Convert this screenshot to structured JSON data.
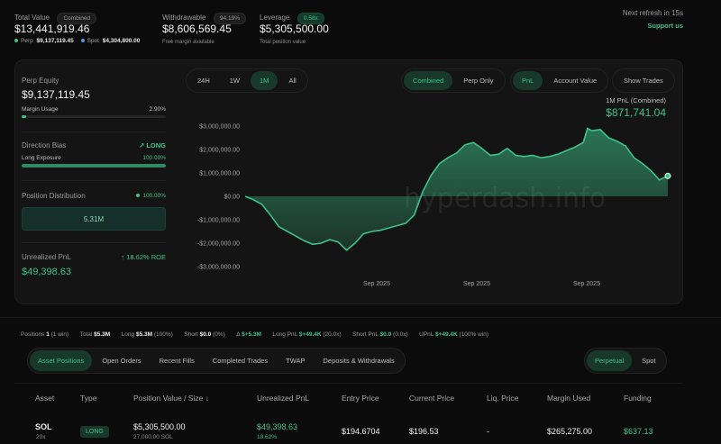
{
  "header": {
    "total_value_label": "Total Value",
    "total_value_badge": "Combined",
    "total_value": "$13,441,919.46",
    "perp_label": "Perp",
    "perp_value": "$9,137,119.45",
    "spot_label": "Spot",
    "spot_value": "$4,304,800.00",
    "withdrawable_label": "Withdrawable",
    "withdrawable_badge": "94.19%",
    "withdrawable_value": "$8,606,569.45",
    "withdrawable_sub": "Free margin available",
    "leverage_label": "Leverage",
    "leverage_badge": "0.58x",
    "leverage_value": "$5,305,500.00",
    "leverage_sub": "Total position value",
    "refresh_text": "Next refresh in 15s",
    "support_link": "Support us"
  },
  "sidebar": {
    "perp_equity_label": "Perp Equity",
    "perp_equity_value": "$9,137,119.45",
    "margin_usage_label": "Margin Usage",
    "margin_usage_value": "2.90%",
    "margin_usage_fraction": 0.029,
    "direction_bias_label": "Direction Bias",
    "direction_bias_value": "LONG",
    "long_exposure_label": "Long Exposure",
    "long_exposure_value": "100.00%",
    "long_exposure_fraction": 1.0,
    "position_distribution_label": "Position Distribution",
    "position_distribution_value": "100.00%",
    "distribution_box_value": "5.31M",
    "unrealized_pnl_label": "Unrealized PnL",
    "unrealized_roe": "18.62% ROE",
    "unrealized_pnl_value": "$49,398.63"
  },
  "chart_controls": {
    "ranges": [
      "24H",
      "1W",
      "1M",
      "All"
    ],
    "active_range": "1M",
    "modes": [
      "Combined",
      "Perp Only"
    ],
    "active_mode": "Combined",
    "metrics": [
      "PnL",
      "Account Value"
    ],
    "active_metric": "PnL",
    "show_trades": "Show Trades"
  },
  "chart_header": {
    "caption": "1M PnL (Combined)",
    "value": "$871,741.04"
  },
  "watermark": "hyperdash.info",
  "chart_data": {
    "type": "area",
    "y_ticks": [
      "$3,000,000.00",
      "$2,000,000.00",
      "$1,000,000.00",
      "$0.00",
      "-$1,000,000.00",
      "-$2,000,000.00",
      "-$3,000,000.00"
    ],
    "ylim": [
      -3000000,
      3000000
    ],
    "x_tick_labels": [
      "Sep 2025",
      "Sep 2025",
      "Sep 2025",
      "Sep 2025"
    ],
    "x_tick_positions": [
      0.23,
      0.45,
      0.71,
      0.96
    ],
    "x": [
      0,
      0.02,
      0.04,
      0.06,
      0.08,
      0.1,
      0.12,
      0.14,
      0.16,
      0.18,
      0.2,
      0.22,
      0.24,
      0.26,
      0.28,
      0.3,
      0.32,
      0.34,
      0.36,
      0.38,
      0.4,
      0.42,
      0.44,
      0.46,
      0.48,
      0.5,
      0.52,
      0.54,
      0.56,
      0.58,
      0.6,
      0.62,
      0.64,
      0.66,
      0.68,
      0.7,
      0.72,
      0.74,
      0.76,
      0.78,
      0.8,
      0.81,
      0.82,
      0.84,
      0.86,
      0.88,
      0.9,
      0.92,
      0.94,
      0.96,
      0.98,
      1.0
    ],
    "values": [
      0,
      -150000,
      -350000,
      -800000,
      -1300000,
      -1500000,
      -1700000,
      -1900000,
      -2050000,
      -2000000,
      -1850000,
      -1950000,
      -2300000,
      -2000000,
      -1600000,
      -1500000,
      -1450000,
      -1350000,
      -1250000,
      -1150000,
      -800000,
      200000,
      900000,
      1400000,
      1650000,
      1850000,
      2200000,
      2300000,
      2050000,
      1750000,
      1800000,
      2050000,
      1750000,
      1700000,
      1750000,
      1650000,
      1700000,
      1800000,
      1950000,
      2100000,
      2300000,
      2900000,
      2800000,
      2850000,
      2500000,
      2350000,
      2150000,
      1650000,
      1400000,
      1100000,
      700000,
      871741
    ]
  },
  "stats_bar": {
    "positions_label": "Positions",
    "positions_value": "1",
    "positions_sub": "(1 win)",
    "total_label": "Total",
    "total_value": "$5.3M",
    "long_label": "Long",
    "long_value": "$5.3M",
    "long_sub": "(100%)",
    "short_label": "Short",
    "short_value": "$0.0",
    "short_sub": "(0%)",
    "delta_label": "Δ",
    "delta_value": "$+5.3M",
    "long_pnl_label": "Long PnL",
    "long_pnl_value": "$+49.4K",
    "long_pnl_sub": "(20.0x)",
    "short_pnl_label": "Short PnL",
    "short_pnl_value": "$0.0",
    "short_pnl_sub": "(0.0x)",
    "upnl_label": "UPnL",
    "upnl_value": "$+49.4K",
    "upnl_sub": "(100% win)"
  },
  "table_tabs": {
    "tabs": [
      "Asset Positions",
      "Open Orders",
      "Recent Fills",
      "Completed Trades",
      "TWAP",
      "Deposits & Withdrawals"
    ],
    "active": "Asset Positions",
    "right_tabs": [
      "Perpetual",
      "Spot"
    ],
    "right_active": "Perpetual"
  },
  "table": {
    "headers": [
      "Asset",
      "Type",
      "Position Value / Size",
      "Unrealized PnL",
      "Entry Price",
      "Current Price",
      "Liq. Price",
      "Margin Used",
      "Funding"
    ],
    "sort_indicator": "↓",
    "row": {
      "asset": "SOL",
      "leverage": "20x",
      "type": "LONG",
      "position_value": "$5,305,500.00",
      "position_size": "27,000.00 SOL",
      "upnl": "$49,398.63",
      "upnl_pct": "18.62%",
      "entry_price": "$194.6704",
      "current_price": "$196.53",
      "liq_price": "-",
      "margin_used": "$265,275.00",
      "funding": "$637.13"
    }
  },
  "colors": {
    "accent": "#3ec28a",
    "accent_bg": "#17382a",
    "background": "#0b0b0b",
    "panel": "#141414"
  }
}
